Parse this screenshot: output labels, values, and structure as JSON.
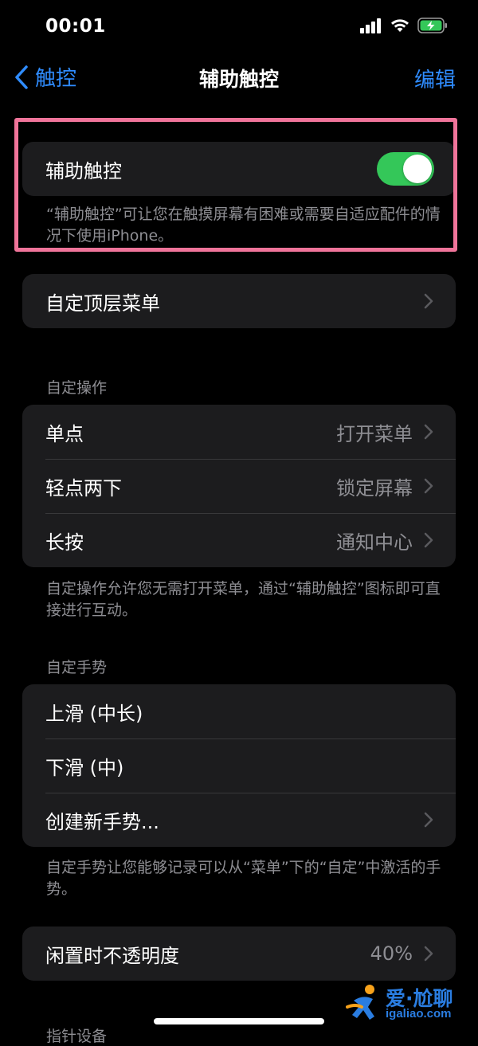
{
  "status_bar": {
    "time": "00:01"
  },
  "nav": {
    "back_label": "触控",
    "title": "辅助触控",
    "edit_label": "编辑"
  },
  "assistive_touch": {
    "label": "辅助触控",
    "toggle_on": true,
    "footer": "“辅助触控”可让您在触摸屏幕有困难或需要自适应配件的情况下使用iPhone。"
  },
  "top_menu": {
    "label": "自定顶层菜单"
  },
  "custom_actions": {
    "header": "自定操作",
    "rows": [
      {
        "label": "单点",
        "value": "打开菜单"
      },
      {
        "label": "轻点两下",
        "value": "锁定屏幕"
      },
      {
        "label": "长按",
        "value": "通知中心"
      }
    ],
    "footer": "自定操作允许您无需打开菜单，通过“辅助触控”图标即可直接进行互动。"
  },
  "custom_gestures": {
    "header": "自定手势",
    "rows": [
      {
        "label": "上滑 (中长)"
      },
      {
        "label": "下滑 (中)"
      },
      {
        "label": "创建新手势..."
      }
    ],
    "footer": "自定手势让您能够记录可以从“菜单”下的“自定”中激活的手势。"
  },
  "idle_opacity": {
    "label": "闲置时不透明度",
    "value": "40%"
  },
  "next_section_header": "指针设备",
  "watermark": {
    "text": "爱·尬聊",
    "url": "igaliao.com"
  },
  "colors": {
    "accent": "#2f8cff",
    "toggle_on": "#34c759",
    "highlight": "#f0749a",
    "group_bg": "#1c1c1e"
  }
}
